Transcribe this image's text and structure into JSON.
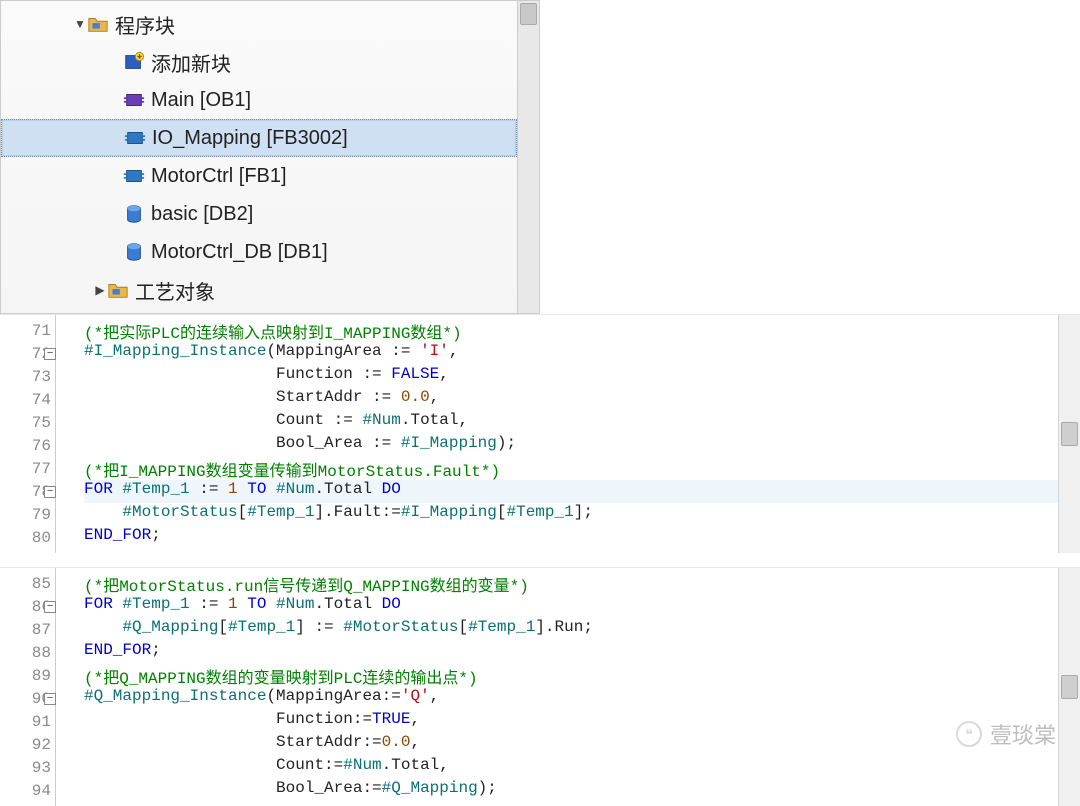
{
  "tree": {
    "items": [
      {
        "label": "程序块",
        "icon": "folder",
        "indent": 72,
        "arrow": "down",
        "selected": false
      },
      {
        "label": "添加新块",
        "icon": "add",
        "indent": 122,
        "selected": false
      },
      {
        "label": "Main [OB1]",
        "icon": "ob",
        "indent": 122,
        "selected": false
      },
      {
        "label": "IO_Mapping [FB3002]",
        "icon": "fb",
        "indent": 122,
        "selected": true
      },
      {
        "label": "MotorCtrl [FB1]",
        "icon": "fb",
        "indent": 122,
        "selected": false
      },
      {
        "label": "basic [DB2]",
        "icon": "db",
        "indent": 122,
        "selected": false
      },
      {
        "label": "MotorCtrl_DB [DB1]",
        "icon": "db",
        "indent": 122,
        "selected": false
      },
      {
        "label": "工艺对象",
        "icon": "folder",
        "indent": 92,
        "arrow": "right",
        "selected": false
      }
    ]
  },
  "code1": {
    "lines": [
      {
        "n": "71",
        "t": [
          [
            "cm",
            "(*把实际PLC的连续输入点映射到I_MAPPING数组*)"
          ]
        ]
      },
      {
        "n": "72",
        "fold": true,
        "t": [
          [
            "id",
            "#I_Mapping_Instance"
          ],
          [
            "txt",
            "(MappingArea "
          ],
          [
            "txt",
            ":= "
          ],
          [
            "str",
            "'I'"
          ],
          [
            "txt",
            ","
          ]
        ]
      },
      {
        "n": "73",
        "t": [
          [
            "txt",
            "                    Function := "
          ],
          [
            "kw",
            "FALSE"
          ],
          [
            "txt",
            ","
          ]
        ]
      },
      {
        "n": "74",
        "t": [
          [
            "txt",
            "                    StartAddr := "
          ],
          [
            "num",
            "0.0"
          ],
          [
            "txt",
            ","
          ]
        ]
      },
      {
        "n": "75",
        "t": [
          [
            "txt",
            "                    Count := "
          ],
          [
            "id",
            "#Num"
          ],
          [
            "txt",
            ".Total,"
          ]
        ]
      },
      {
        "n": "76",
        "t": [
          [
            "txt",
            "                    Bool_Area := "
          ],
          [
            "id",
            "#I_Mapping"
          ],
          [
            "txt",
            ");"
          ]
        ]
      },
      {
        "n": "77",
        "t": [
          [
            "cm",
            "(*把I_MAPPING数组变量传输到MotorStatus.Fault*)"
          ]
        ]
      },
      {
        "n": "78",
        "fold": true,
        "hl": true,
        "t": [
          [
            "kw",
            "FOR "
          ],
          [
            "id",
            "#Temp_1"
          ],
          [
            "txt",
            " := "
          ],
          [
            "num",
            "1"
          ],
          [
            "kw",
            " TO "
          ],
          [
            "id",
            "#Num"
          ],
          [
            "txt",
            ".Total "
          ],
          [
            "kw",
            "DO"
          ]
        ]
      },
      {
        "n": "79",
        "t": [
          [
            "txt",
            "    "
          ],
          [
            "id",
            "#MotorStatus"
          ],
          [
            "txt",
            "["
          ],
          [
            "id",
            "#Temp_1"
          ],
          [
            "txt",
            "].Fault:="
          ],
          [
            "id",
            "#I_Mapping"
          ],
          [
            "txt",
            "["
          ],
          [
            "id",
            "#Temp_1"
          ],
          [
            "txt",
            "];"
          ]
        ]
      },
      {
        "n": "80",
        "t": [
          [
            "kw",
            "END_FOR"
          ],
          [
            "txt",
            ";"
          ]
        ]
      }
    ]
  },
  "code2": {
    "lines": [
      {
        "n": "85",
        "t": [
          [
            "cm",
            "(*把MotorStatus.run信号传递到Q_MAPPING数组的变量*)"
          ]
        ]
      },
      {
        "n": "86",
        "fold": true,
        "t": [
          [
            "kw",
            "FOR "
          ],
          [
            "id",
            "#Temp_1"
          ],
          [
            "txt",
            " := "
          ],
          [
            "num",
            "1"
          ],
          [
            "kw",
            " TO "
          ],
          [
            "id",
            "#Num"
          ],
          [
            "txt",
            ".Total "
          ],
          [
            "kw",
            "DO"
          ]
        ]
      },
      {
        "n": "87",
        "t": [
          [
            "txt",
            "    "
          ],
          [
            "id",
            "#Q_Mapping"
          ],
          [
            "txt",
            "["
          ],
          [
            "id",
            "#Temp_1"
          ],
          [
            "txt",
            "] := "
          ],
          [
            "id",
            "#MotorStatus"
          ],
          [
            "txt",
            "["
          ],
          [
            "id",
            "#Temp_1"
          ],
          [
            "txt",
            "].Run;"
          ]
        ]
      },
      {
        "n": "88",
        "t": [
          [
            "kw",
            "END_FOR"
          ],
          [
            "txt",
            ";"
          ]
        ]
      },
      {
        "n": "89",
        "t": [
          [
            "cm",
            "(*把Q_MAPPING数组的变量映射到PLC连续的输出点*)"
          ]
        ]
      },
      {
        "n": "90",
        "fold": true,
        "t": [
          [
            "id",
            "#Q_Mapping_Instance"
          ],
          [
            "txt",
            "(MappingArea:="
          ],
          [
            "str",
            "'Q'"
          ],
          [
            "txt",
            ","
          ]
        ]
      },
      {
        "n": "91",
        "t": [
          [
            "txt",
            "                    Function:="
          ],
          [
            "kw",
            "TRUE"
          ],
          [
            "txt",
            ","
          ]
        ]
      },
      {
        "n": "92",
        "t": [
          [
            "txt",
            "                    StartAddr:="
          ],
          [
            "num",
            "0.0"
          ],
          [
            "txt",
            ","
          ]
        ]
      },
      {
        "n": "93",
        "t": [
          [
            "txt",
            "                    Count:="
          ],
          [
            "id",
            "#Num"
          ],
          [
            "txt",
            ".Total,"
          ]
        ]
      },
      {
        "n": "94",
        "t": [
          [
            "txt",
            "                    Bool_Area:="
          ],
          [
            "id",
            "#Q_Mapping"
          ],
          [
            "txt",
            ");"
          ]
        ]
      }
    ]
  },
  "watermark": {
    "label": "壹琰棠"
  }
}
